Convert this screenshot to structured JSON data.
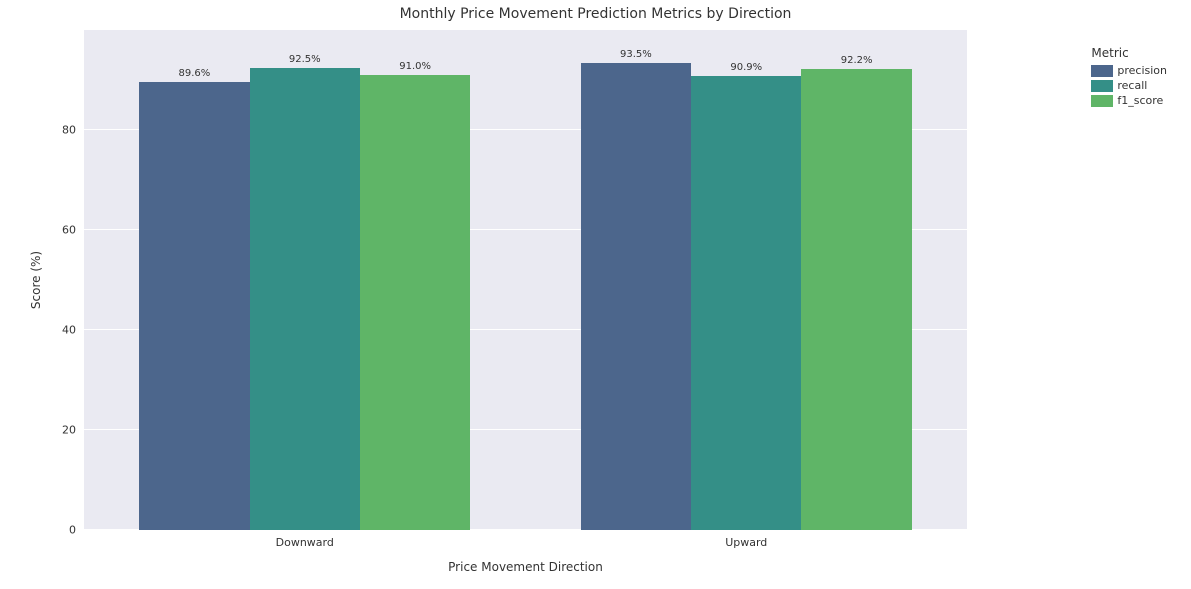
{
  "chart_data": {
    "type": "bar",
    "title": "Monthly Price Movement Prediction Metrics by Direction",
    "xlabel": "Price Movement Direction",
    "ylabel": "Score (%)",
    "ylim": [
      0,
      100
    ],
    "yticks": [
      0,
      20,
      40,
      60,
      80
    ],
    "categories": [
      "Downward",
      "Upward"
    ],
    "series": [
      {
        "name": "precision",
        "color": "#4c668c",
        "values": [
          89.6,
          93.5
        ]
      },
      {
        "name": "recall",
        "color": "#348f87",
        "values": [
          92.5,
          90.9
        ]
      },
      {
        "name": "f1_score",
        "color": "#5fb567",
        "values": [
          91.0,
          92.2
        ]
      }
    ],
    "legend_title": "Metric",
    "bar_labels": {
      "Downward": {
        "precision": "89.6%",
        "recall": "92.5%",
        "f1_score": "91.0%"
      },
      "Upward": {
        "precision": "93.5%",
        "recall": "90.9%",
        "f1_score": "92.2%"
      }
    }
  }
}
